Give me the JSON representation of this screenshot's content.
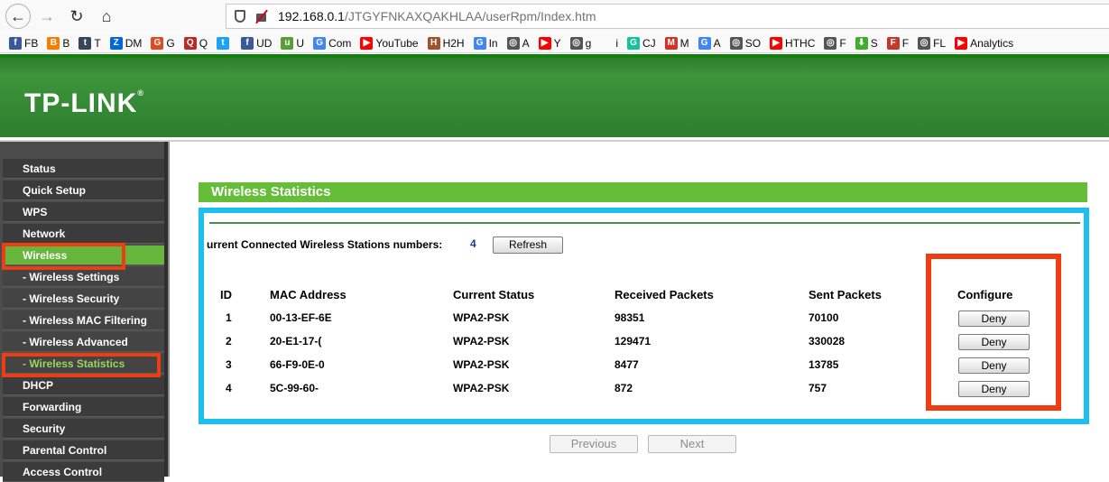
{
  "browser": {
    "url_host": "192.168.0.1",
    "url_path": "/JTGYFNKAXQAKHLAA/userRpm/Index.htm",
    "bookmarks": [
      {
        "label": "FB",
        "icon": "facebook-icon",
        "color": "#3b5998",
        "glyph": "f"
      },
      {
        "label": "B",
        "icon": "blogger-icon",
        "color": "#f57d00",
        "glyph": "B"
      },
      {
        "label": "T",
        "icon": "tumblr-icon",
        "color": "#35465c",
        "glyph": "t"
      },
      {
        "label": "DM",
        "icon": "dailymotion-icon",
        "color": "#0066dc",
        "glyph": "Z"
      },
      {
        "label": "G",
        "icon": "swirl-icon",
        "color": "#e04a1f",
        "glyph": "G"
      },
      {
        "label": "Q",
        "icon": "q-icon",
        "color": "#b92b27",
        "glyph": "Q"
      },
      {
        "label": "",
        "icon": "twitter-icon",
        "color": "#1da1f2",
        "glyph": "t"
      },
      {
        "label": "UD",
        "icon": "facebook-icon",
        "color": "#3b5998",
        "glyph": "f"
      },
      {
        "label": "U",
        "icon": "site-icon",
        "color": "#5a9e3a",
        "glyph": "u"
      },
      {
        "label": "Com",
        "icon": "google-icon",
        "color": "#4285f4",
        "glyph": "G"
      },
      {
        "label": "YouTube",
        "icon": "youtube-icon",
        "color": "#ff0000",
        "glyph": "▶"
      },
      {
        "label": "H2H",
        "icon": "h2h-icon",
        "color": "#a0522d",
        "glyph": "H"
      },
      {
        "label": "In",
        "icon": "google-icon",
        "color": "#4285f4",
        "glyph": "G"
      },
      {
        "label": "A",
        "icon": "globe-icon",
        "color": "#555555",
        "glyph": "◎"
      },
      {
        "label": "Y",
        "icon": "youtube-icon",
        "color": "#ff0000",
        "glyph": "▶"
      },
      {
        "label": "g",
        "icon": "globe-icon",
        "color": "#555555",
        "glyph": "◎"
      },
      {
        "label": "i",
        "icon": "blank-icon",
        "color": "#f9f9fa",
        "glyph": ""
      },
      {
        "label": "CJ",
        "icon": "grammarly-icon",
        "color": "#15c39a",
        "glyph": "G"
      },
      {
        "label": "M",
        "icon": "gmail-icon",
        "color": "#d93025",
        "glyph": "M"
      },
      {
        "label": "A",
        "icon": "google-icon",
        "color": "#4285f4",
        "glyph": "G"
      },
      {
        "label": "SO",
        "icon": "globe-icon",
        "color": "#555555",
        "glyph": "◎"
      },
      {
        "label": "HTHC",
        "icon": "youtube-icon",
        "color": "#ff0000",
        "glyph": "▶"
      },
      {
        "label": "F",
        "icon": "globe-icon",
        "color": "#555555",
        "glyph": "◎"
      },
      {
        "label": "S",
        "icon": "download-icon",
        "color": "#3fae2a",
        "glyph": "⬇"
      },
      {
        "label": "F",
        "icon": "f-icon",
        "color": "#c0392b",
        "glyph": "F"
      },
      {
        "label": "FL",
        "icon": "globe-icon",
        "color": "#555555",
        "glyph": "◎"
      },
      {
        "label": "Analytics",
        "icon": "youtube-icon",
        "color": "#ff0000",
        "glyph": "▶"
      }
    ]
  },
  "brand": {
    "logo": "TP-LINK",
    "trademark": "®"
  },
  "sidebar": {
    "items": [
      {
        "label": "Status",
        "type": "main"
      },
      {
        "label": "Quick Setup",
        "type": "main"
      },
      {
        "label": "WPS",
        "type": "main"
      },
      {
        "label": "Network",
        "type": "main"
      },
      {
        "label": "Wireless",
        "type": "active"
      },
      {
        "label": "- Wireless Settings",
        "type": "sub"
      },
      {
        "label": "- Wireless Security",
        "type": "sub"
      },
      {
        "label": "- Wireless MAC Filtering",
        "type": "sub"
      },
      {
        "label": "- Wireless Advanced",
        "type": "sub"
      },
      {
        "label": "- Wireless Statistics",
        "type": "current"
      },
      {
        "label": "DHCP",
        "type": "main"
      },
      {
        "label": "Forwarding",
        "type": "main"
      },
      {
        "label": "Security",
        "type": "main"
      },
      {
        "label": "Parental Control",
        "type": "main"
      },
      {
        "label": "Access Control",
        "type": "main"
      }
    ]
  },
  "page": {
    "title": "Wireless Statistics",
    "stations_label": "urrent Connected Wireless Stations numbers:",
    "stations_count": "4",
    "refresh_label": "Refresh",
    "columns": [
      "ID",
      "MAC Address",
      "Current Status",
      "Received Packets",
      "Sent Packets",
      "Configure"
    ],
    "rows": [
      {
        "id": "1",
        "mac": "00-13-EF-6E",
        "status": "WPA2-PSK",
        "received": "98351",
        "sent": "70100",
        "action": "Deny"
      },
      {
        "id": "2",
        "mac": "20-E1-17-(",
        "status": "WPA2-PSK",
        "received": "129471",
        "sent": "330028",
        "action": "Deny"
      },
      {
        "id": "3",
        "mac": "66-F9-0E-0",
        "status": "WPA2-PSK",
        "received": "8477",
        "sent": "13785",
        "action": "Deny"
      },
      {
        "id": "4",
        "mac": "5C-99-60-",
        "status": "WPA2-PSK",
        "received": "872",
        "sent": "757",
        "action": "Deny"
      }
    ],
    "previous_label": "Previous",
    "next_label": "Next"
  },
  "colors": {
    "brand_green": "#3d953b",
    "title_green": "#66bd38",
    "highlight_blue": "#1cbfee",
    "highlight_red": "#ee3d13"
  }
}
